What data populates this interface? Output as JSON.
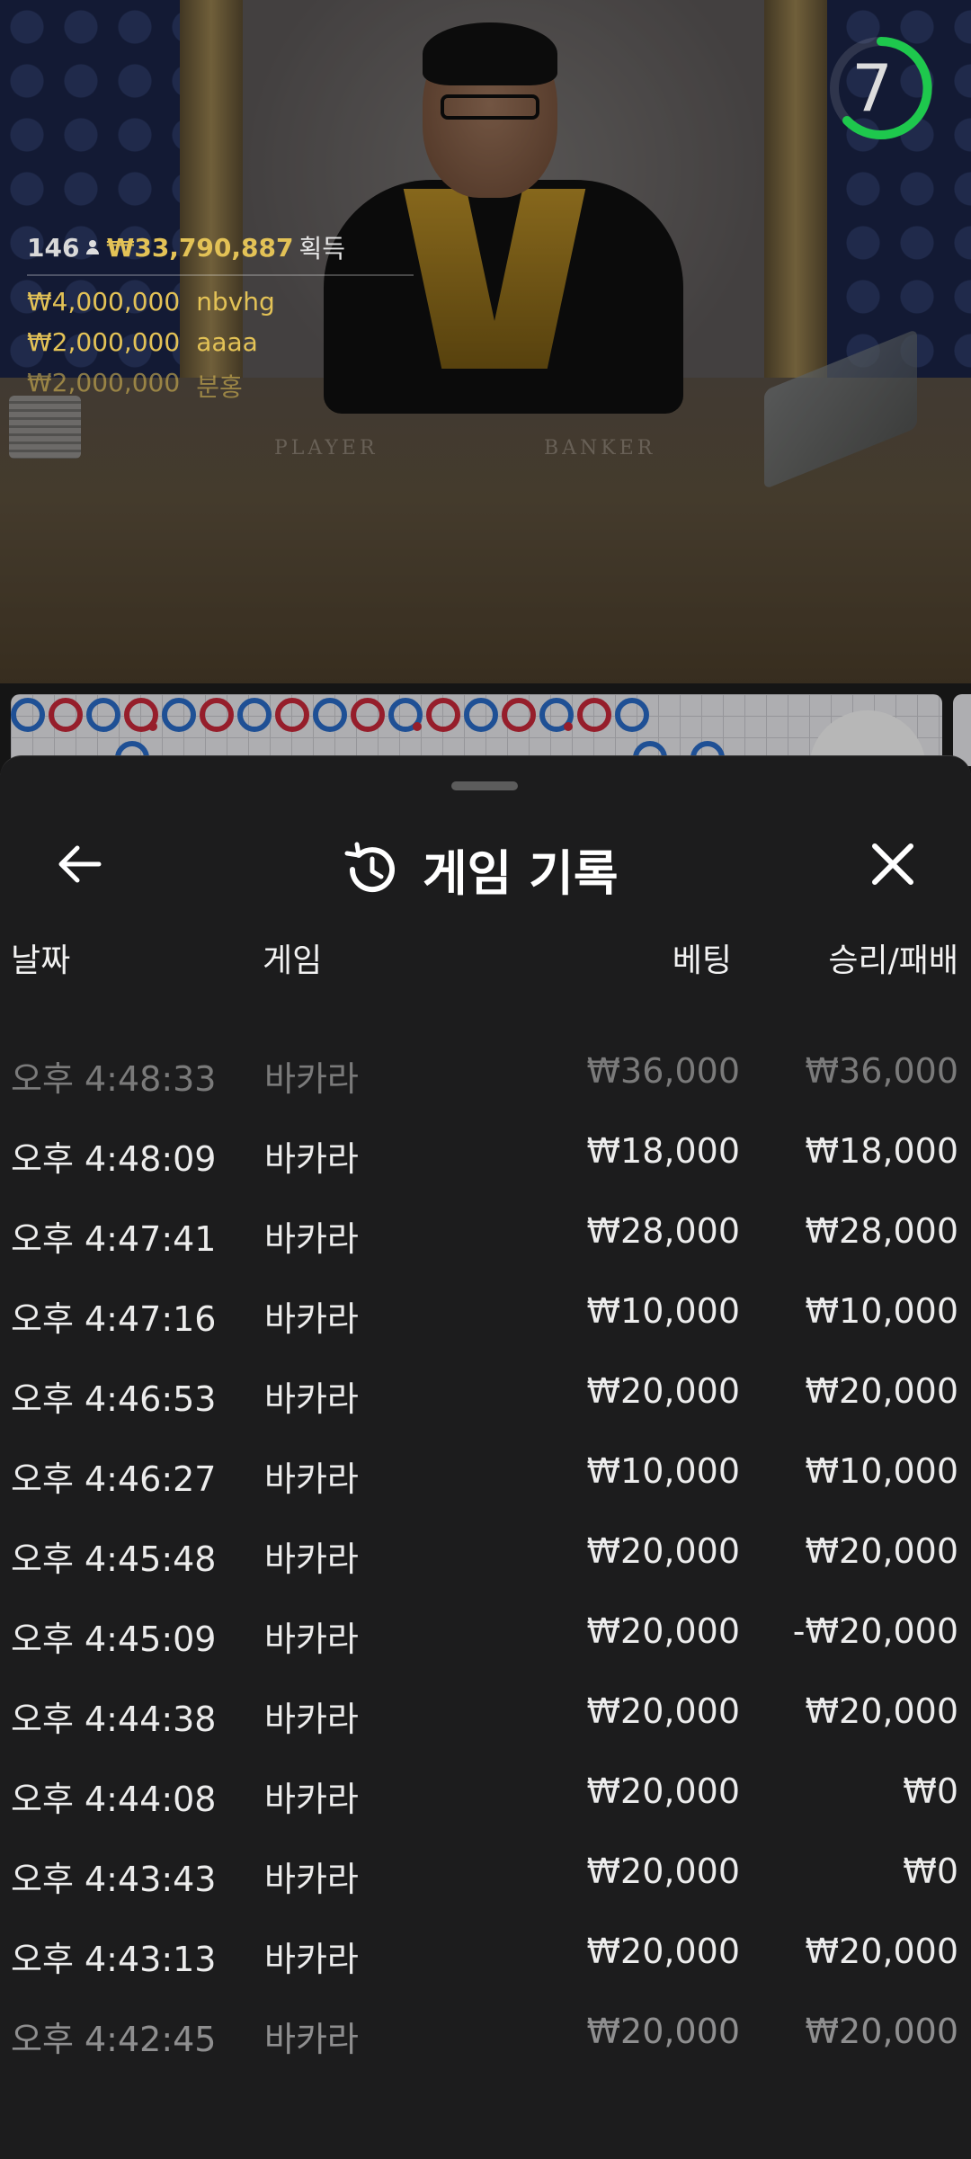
{
  "video": {
    "table_labels": {
      "player": "PLAYER",
      "banker": "BANKER"
    },
    "countdown": "7",
    "winners": {
      "count": "146",
      "total": "₩33,790,887",
      "suffix": "획득",
      "list": [
        {
          "amount": "₩4,000,000",
          "name": "nbvhg"
        },
        {
          "amount": "₩2,000,000",
          "name": "aaaa"
        },
        {
          "amount": "₩2,000,000",
          "name": "분홍"
        }
      ]
    }
  },
  "roadmap": {
    "row1": [
      "blue",
      "red",
      "blue",
      "red-tie",
      "blue",
      "red",
      "blue",
      "red",
      "blue",
      "red",
      "blue-tie",
      "red",
      "blue",
      "red",
      "blue-tie",
      "red",
      "blue"
    ]
  },
  "sheet": {
    "title": "게임 기록",
    "columns": {
      "date": "날짜",
      "game": "게임",
      "bet": "베팅",
      "result": "승리/패배"
    },
    "rows": [
      {
        "date": "오후 4:48:33",
        "game": "바카라",
        "bet": "₩36,000",
        "result": "₩36,000"
      },
      {
        "date": "오후 4:48:09",
        "game": "바카라",
        "bet": "₩18,000",
        "result": "₩18,000"
      },
      {
        "date": "오후 4:47:41",
        "game": "바카라",
        "bet": "₩28,000",
        "result": "₩28,000"
      },
      {
        "date": "오후 4:47:16",
        "game": "바카라",
        "bet": "₩10,000",
        "result": "₩10,000"
      },
      {
        "date": "오후 4:46:53",
        "game": "바카라",
        "bet": "₩20,000",
        "result": "₩20,000"
      },
      {
        "date": "오후 4:46:27",
        "game": "바카라",
        "bet": "₩10,000",
        "result": "₩10,000"
      },
      {
        "date": "오후 4:45:48",
        "game": "바카라",
        "bet": "₩20,000",
        "result": "₩20,000"
      },
      {
        "date": "오후 4:45:09",
        "game": "바카라",
        "bet": "₩20,000",
        "result": "-₩20,000"
      },
      {
        "date": "오후 4:44:38",
        "game": "바카라",
        "bet": "₩20,000",
        "result": "₩20,000"
      },
      {
        "date": "오후 4:44:08",
        "game": "바카라",
        "bet": "₩20,000",
        "result": "₩0"
      },
      {
        "date": "오후 4:43:43",
        "game": "바카라",
        "bet": "₩20,000",
        "result": "₩0"
      },
      {
        "date": "오후 4:43:13",
        "game": "바카라",
        "bet": "₩20,000",
        "result": "₩20,000"
      },
      {
        "date": "오후 4:42:45",
        "game": "바카라",
        "bet": "₩20,000",
        "result": "₩20,000"
      }
    ]
  }
}
